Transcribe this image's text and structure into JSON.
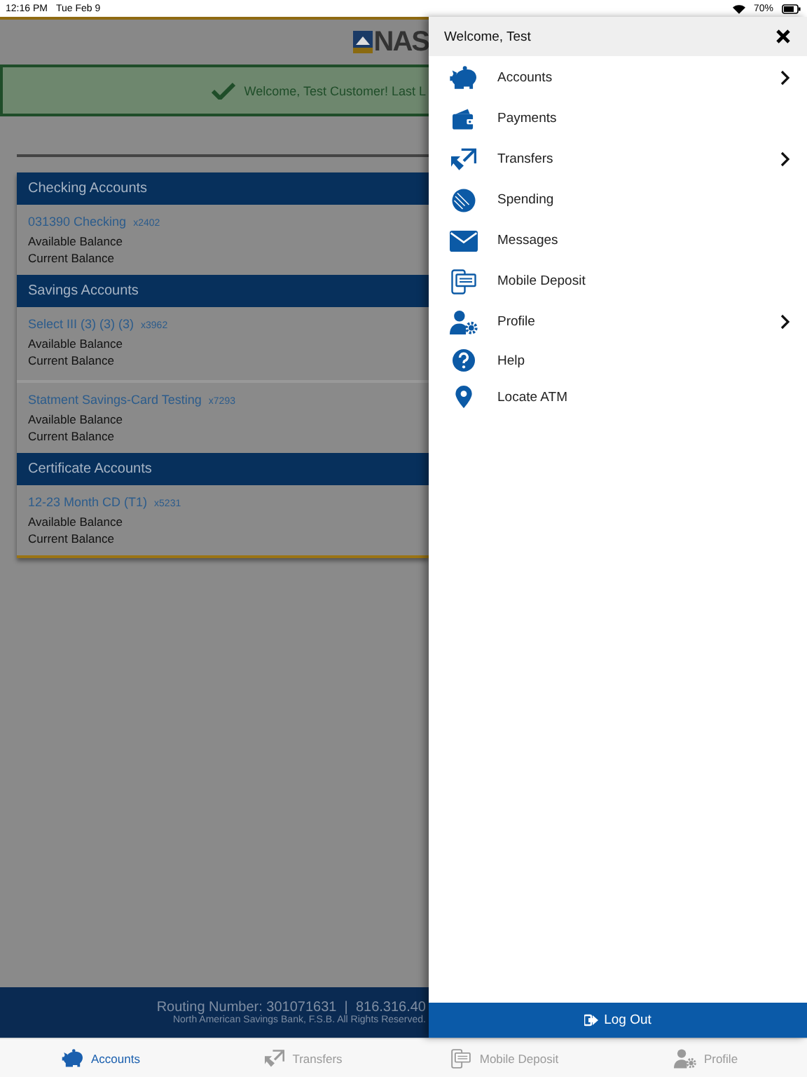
{
  "status_bar": {
    "time": "12:16 PM",
    "date": "Tue Feb 9",
    "battery": "70%"
  },
  "header": {
    "logo": "NAS"
  },
  "banner": {
    "message": "Welcome, Test Customer! Last L"
  },
  "account_groups": [
    {
      "title": "Checking Accounts",
      "accounts": [
        {
          "name": "031390 Checking",
          "number": "x2402",
          "available_label": "Available Balance",
          "current_label": "Current Balance"
        }
      ]
    },
    {
      "title": "Savings Accounts",
      "accounts": [
        {
          "name": "Select III (3) (3) (3)",
          "number": "x3962",
          "available_label": "Available Balance",
          "current_label": "Current Balance"
        },
        {
          "name": "Statment Savings-Card Testing",
          "number": "x7293",
          "available_label": "Available Balance",
          "current_label": "Current Balance"
        }
      ]
    },
    {
      "title": "Certificate Accounts",
      "accounts": [
        {
          "name": "12-23 Month CD (T1)",
          "number": "x5231",
          "available_label": "Available Balance",
          "current_label": "Current Balance"
        }
      ]
    }
  ],
  "footer": {
    "routing": "Routing Number: 301071631  |  816.316.40",
    "copyright": "North American Savings Bank, F.S.B. All Rights Reserved."
  },
  "menu": {
    "greeting": "Welcome, Test",
    "items": [
      {
        "label": "Accounts",
        "has_submenu": true
      },
      {
        "label": "Payments",
        "has_submenu": false
      },
      {
        "label": "Transfers",
        "has_submenu": true
      },
      {
        "label": "Spending",
        "has_submenu": false
      },
      {
        "label": "Messages",
        "has_submenu": false
      },
      {
        "label": "Mobile Deposit",
        "has_submenu": false
      },
      {
        "label": "Profile",
        "has_submenu": true
      },
      {
        "label": "Help",
        "has_submenu": false
      },
      {
        "label": "Locate ATM",
        "has_submenu": false
      }
    ],
    "logout": "Log Out"
  },
  "tab_bar": [
    {
      "label": "Accounts",
      "selected": true
    },
    {
      "label": "Transfers",
      "selected": false
    },
    {
      "label": "Mobile Deposit",
      "selected": false
    },
    {
      "label": "Profile",
      "selected": false
    }
  ]
}
